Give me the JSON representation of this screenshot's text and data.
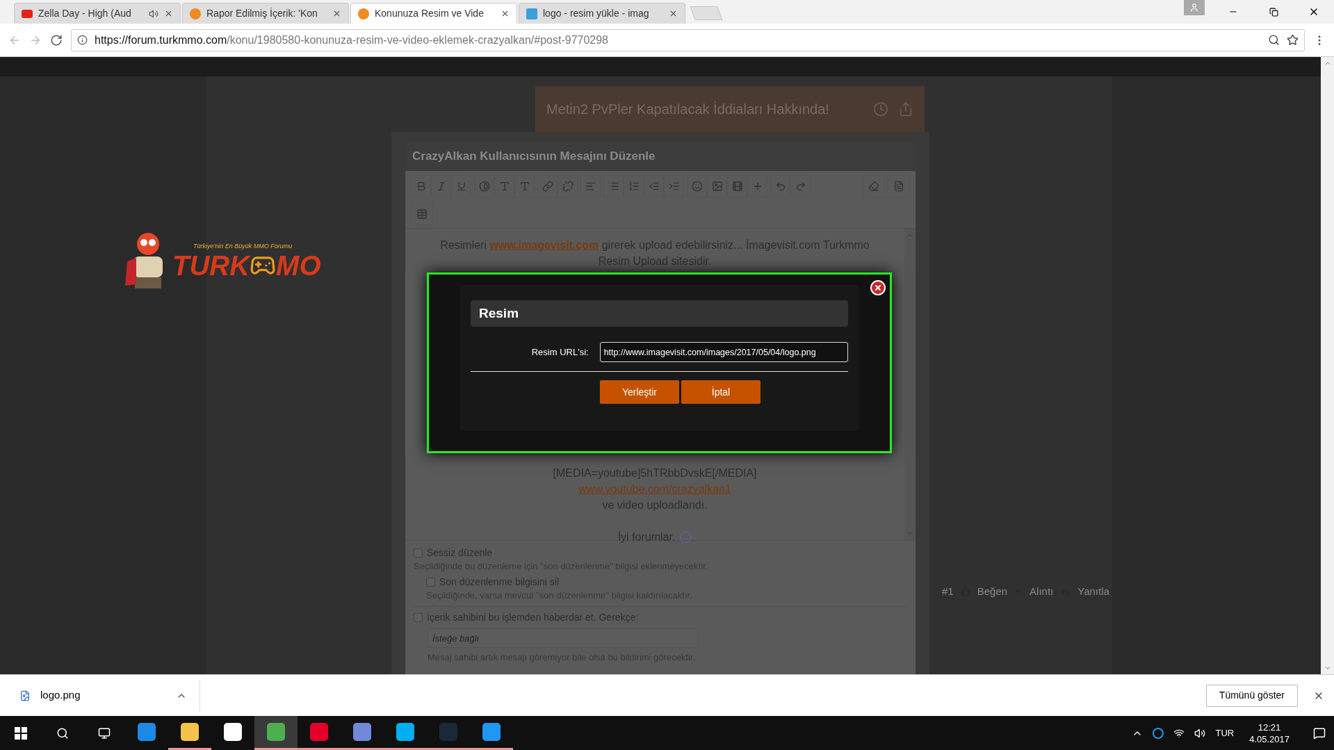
{
  "browser": {
    "tabs": [
      {
        "title": "Zella Day - High (Aud",
        "kind": "youtube",
        "audio": true,
        "selected": false
      },
      {
        "title": "Rapor Edilmiş İçerik: 'Kon",
        "kind": "forum",
        "audio": false,
        "selected": false
      },
      {
        "title": "Konunuza Resim ve Vide",
        "kind": "forum",
        "audio": false,
        "selected": true
      },
      {
        "title": "logo - resim yükle - imag",
        "kind": "iv",
        "audio": false,
        "selected": false
      }
    ],
    "url_host": "https://forum.turkmmo.com",
    "url_path": "/konu/1980580-konunuza-resim-ve-video-eklemek-crazyalkan/#post-9770298"
  },
  "logo": {
    "tagline": "Türkiye'nin En Büyük MMO Forumu",
    "word_left": "TURK",
    "word_right": "MO"
  },
  "article": {
    "title": "Metin2 PvPler Kapatılacak İddiaları Hakkında!"
  },
  "editor": {
    "title": "CrazyAlkan Kullanıcısının Mesajını Düzenle",
    "intro": {
      "before": "Resimleri",
      "link": "www.imagevisit.com",
      "after": "girerek upload edebilirsiniz... İmagevisit.com Turkmmo Resim Upload sitesidir."
    },
    "lines": [
      {
        "text": "[MEDIA=youtube]5hTRbbDvskE[/MEDIA]",
        "kind": "text"
      },
      {
        "text": "www.youtube.com/crazyalkan1",
        "kind": "link"
      },
      {
        "text": "ve video uploadlandı.",
        "kind": "text"
      },
      {
        "text": "İyi forumlar.",
        "kind": "emoji"
      }
    ],
    "options": [
      {
        "label": "Sessiz düzenle",
        "help": "Seçildiğinde bu düzenleme için \"son düzenlenme\" bilgisi eklenmeyecektir.",
        "checked": false,
        "children": [
          {
            "label": "Son düzenlenme bilgisini sil",
            "help": "Seçildiğinde, varsa mevcut \"son düzenlenme\" bilgisi kaldırılacaktır.",
            "checked": false
          }
        ]
      },
      {
        "label": "İçerik sahibini bu işlemden haberdar et. Gerekçe:",
        "placeholder": "İsteğe bağlı",
        "help": "Mesaj sahibi artık mesajı göremiyor bile olsa bu bildirimi görecektir.",
        "checked": false
      }
    ]
  },
  "post_actions": {
    "number": "#1",
    "like": "Beğen",
    "quote": "Alıntı",
    "reply": "Yanıtla"
  },
  "modal": {
    "title": "Resim",
    "field_label": "Resim URL'si:",
    "field_value": "http://www.imagevisit.com/images/2017/05/04/logo.png",
    "buttons": [
      "Yerleştir",
      "İptal"
    ]
  },
  "download": {
    "file": "logo.png",
    "show_all": "Tümünü göster"
  },
  "taskbar": {
    "apps": [
      {
        "kind": "edge",
        "running": false,
        "active": false
      },
      {
        "kind": "explorer",
        "running": true,
        "active": false
      },
      {
        "kind": "store",
        "running": false,
        "active": false
      },
      {
        "kind": "chrome",
        "running": true,
        "active": true
      },
      {
        "kind": "instagram",
        "running": true,
        "active": false
      },
      {
        "kind": "discord",
        "running": true,
        "active": false
      },
      {
        "kind": "skype",
        "running": true,
        "active": false
      },
      {
        "kind": "steam",
        "running": true,
        "active": false
      },
      {
        "kind": "ccleaner",
        "running": true,
        "active": false
      }
    ],
    "language": "TUR",
    "time": "12:21",
    "date": "4.05.2017"
  }
}
